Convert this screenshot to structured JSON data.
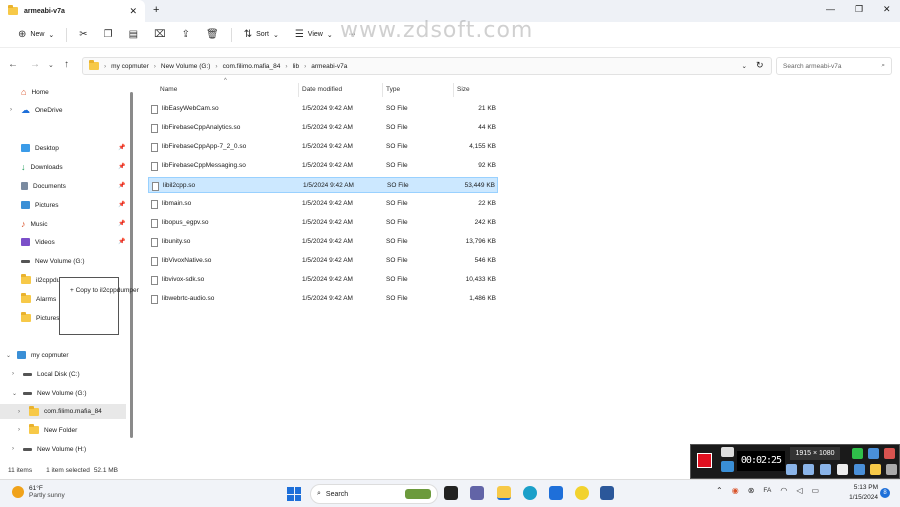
{
  "window": {
    "tab_title": "armeabi-v7a",
    "close_tab": "✕",
    "new_tab": "+",
    "minimize": "—",
    "maximize": "❐",
    "close": "✕"
  },
  "watermark": "www.zdsoft.com",
  "toolbar": {
    "new_label": "New",
    "sort_label": "Sort",
    "view_label": "View",
    "more_label": "···"
  },
  "address": {
    "crumbs": [
      "my copmuter",
      "New Volume (G:)",
      "com.filimo.mafia_84",
      "lib",
      "armeabi-v7a"
    ],
    "search_placeholder": "Search armeabi-v7a"
  },
  "nav": {
    "home": "Home",
    "onedrive": "OneDrive",
    "desktop": "Desktop",
    "downloads": "Downloads",
    "documents": "Documents",
    "pictures": "Pictures",
    "music": "Music",
    "videos": "Videos",
    "new_volume_g": "New Volume (G:)",
    "il2cppdu": "il2cppdu",
    "alarms": "Alarms",
    "pictures2": "Pictures",
    "my_computer": "my copmuter",
    "local_disk": "Local Disk (C:)",
    "new_volume_g2": "New Volume (G:)",
    "com_filimo": "com.filimo.mafia_84",
    "new_folder": "New Folder",
    "new_volume_h": "New Volume (H:)"
  },
  "drag_tooltip": "+ Copy to il2cppdumper",
  "columns": {
    "name": "Name",
    "date": "Date modified",
    "type": "Type",
    "size": "Size"
  },
  "files": [
    {
      "name": "libEasyWebCam.so",
      "date": "1/5/2024 9:42 AM",
      "type": "SO File",
      "size": "21 KB"
    },
    {
      "name": "libFirebaseCppAnalytics.so",
      "date": "1/5/2024 9:42 AM",
      "type": "SO File",
      "size": "44 KB"
    },
    {
      "name": "libFirebaseCppApp-7_2_0.so",
      "date": "1/5/2024 9:42 AM",
      "type": "SO File",
      "size": "4,155 KB"
    },
    {
      "name": "libFirebaseCppMessaging.so",
      "date": "1/5/2024 9:42 AM",
      "type": "SO File",
      "size": "92 KB"
    },
    {
      "name": "libil2cpp.so",
      "date": "1/5/2024 9:42 AM",
      "type": "SO File",
      "size": "53,449 KB"
    },
    {
      "name": "libmain.so",
      "date": "1/5/2024 9:42 AM",
      "type": "SO File",
      "size": "22 KB"
    },
    {
      "name": "libopus_egpv.so",
      "date": "1/5/2024 9:42 AM",
      "type": "SO File",
      "size": "242 KB"
    },
    {
      "name": "libunity.so",
      "date": "1/5/2024 9:42 AM",
      "type": "SO File",
      "size": "13,796 KB"
    },
    {
      "name": "libVivoxNative.so",
      "date": "1/5/2024 9:42 AM",
      "type": "SO File",
      "size": "546 KB"
    },
    {
      "name": "libvivox-sdk.so",
      "date": "1/5/2024 9:42 AM",
      "type": "SO File",
      "size": "10,433 KB"
    },
    {
      "name": "libwebrtc-audio.so",
      "date": "1/5/2024 9:42 AM",
      "type": "SO File",
      "size": "1,486 KB"
    }
  ],
  "status": {
    "items": "11 items",
    "selected": "1 item selected",
    "selected_size": "52.1 MB"
  },
  "taskbar": {
    "temp": "61°F",
    "weather": "Partly sunny",
    "search": "Search",
    "lang": "FA",
    "time": "5:13 PM",
    "date": "1/15/2024",
    "notifications": "8"
  },
  "recorder": {
    "timer": "00:02:25",
    "resolution": "1915 × 1080"
  },
  "colors": {
    "selection": "#cce8ff",
    "accent": "#1e6fd9",
    "record": "#e01020"
  }
}
